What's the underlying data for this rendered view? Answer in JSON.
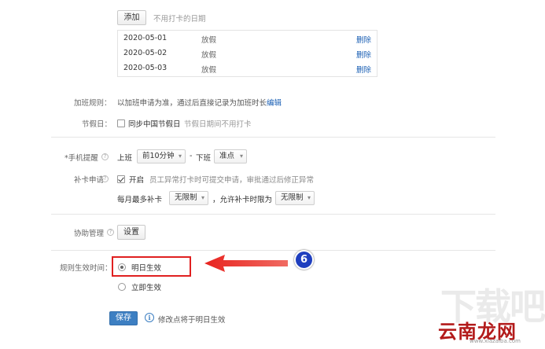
{
  "top": {
    "add_button": "添加",
    "add_hint": "不用打卡的日期"
  },
  "holidays": [
    {
      "date": "2020-05-01",
      "type": "放假",
      "action": "删除"
    },
    {
      "date": "2020-05-02",
      "type": "放假",
      "action": "删除"
    },
    {
      "date": "2020-05-03",
      "type": "放假",
      "action": "删除"
    }
  ],
  "overtime": {
    "label": "加班规则：",
    "text": "以加班申请为准，通过后直接记录为加班时长",
    "edit_link": "编辑"
  },
  "holiday_sync": {
    "label": "节假日：",
    "checkbox_label": "同步中国节假日",
    "hint": "节假日期间不用打卡",
    "checked": false
  },
  "reminder": {
    "label": "*手机提醒",
    "on_label": "上班",
    "on_value": "前10分钟",
    "dash": "-",
    "off_label": "下班",
    "off_value": "准点"
  },
  "makeup": {
    "label": "补卡申请",
    "checked": true,
    "enable_label": "开启",
    "hint": "员工异常打卡时可提交申请，审批通过后修正异常",
    "monthly_label": "每月最多补卡",
    "monthly_value": "无限制",
    "allow_label": "，允许补卡时限为",
    "allow_value": "无限制"
  },
  "assist": {
    "label": "协助管理",
    "button": "设置"
  },
  "effective": {
    "label": "规则生效时间：",
    "options": [
      {
        "label": "明日生效",
        "selected": true
      },
      {
        "label": "立即生效",
        "selected": false
      }
    ]
  },
  "footer": {
    "save_button": "保存",
    "info_icon": "i",
    "note": "修改点将于明日生效"
  },
  "annotation": {
    "step_number": "6",
    "highlight_color": "#e02020",
    "badge_color": "#1f3fbf"
  },
  "watermark": {
    "brand": "云南龙网",
    "faint": "下载吧",
    "url": "www.xiazaiba.com"
  }
}
